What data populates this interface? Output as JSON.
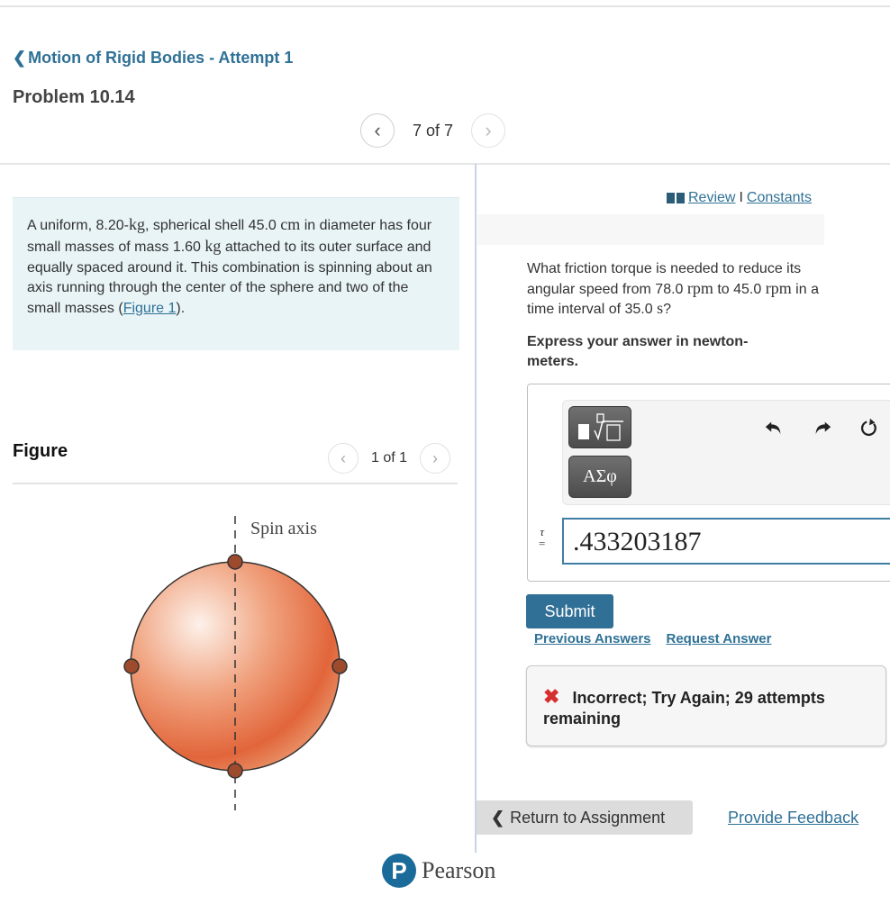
{
  "header": {
    "back_link": "Motion of Rigid Bodies - Attempt 1",
    "problem_title": "Problem 10.14",
    "pager": {
      "count": "7 of 7",
      "prev_icon": "chevron-left-icon",
      "next_icon": "chevron-right-icon"
    }
  },
  "intro": {
    "t1": "A uniform, 8.20-",
    "u1": "kg",
    "t2": ", spherical shell 45.0 ",
    "u2": "cm",
    "t3": " in diameter has four small masses of mass 1.60 ",
    "u3": "kg",
    "t4": " attached to its outer surface and equally spaced around it. This combination is spinning about an axis running through the center of the sphere and two of the small masses (",
    "figure_link": "Figure 1",
    "t5": ")."
  },
  "figure": {
    "title": "Figure",
    "count": "1 of 1",
    "axis_label": "Spin axis",
    "colors": {
      "sphere_light": "#fdf1ea",
      "sphere_dark": "#e2653a",
      "mass": "#9e4a2c",
      "outline": "#333333"
    }
  },
  "resources": {
    "review": "Review",
    "separator": "I",
    "constants": "Constants"
  },
  "question": {
    "q1": "What friction torque is needed to reduce its angular speed from 78.0 ",
    "u1": "rpm",
    "q2": " to 45.0 ",
    "u2": "rpm",
    "q3": " in a time interval of 35.0 ",
    "u3": "s",
    "q4": "?",
    "instruction": "Express your answer in newton-meters."
  },
  "answer": {
    "toolbar": {
      "templates_icon": "templates-icon",
      "greek_label": "ΑΣφ",
      "undo_icon": "undo-icon",
      "redo_icon": "redo-icon",
      "reset_icon": "reset-icon"
    },
    "variable": "τ",
    "equals": "=",
    "value": ".433203187",
    "submit": "Submit",
    "previous_answers": "Previous Answers",
    "request_answer": "Request Answer"
  },
  "feedback": {
    "icon": "✖",
    "message": "Incorrect; Try Again; 29 attempts remaining"
  },
  "footer": {
    "return": "Return to Assignment",
    "provide_feedback": "Provide Feedback",
    "brand": "Pearson",
    "brand_mark": "P"
  },
  "colors": {
    "accent": "#2f7196",
    "submit": "#317096",
    "error": "#d62f2f",
    "intro_bg": "#e9f4f7"
  }
}
